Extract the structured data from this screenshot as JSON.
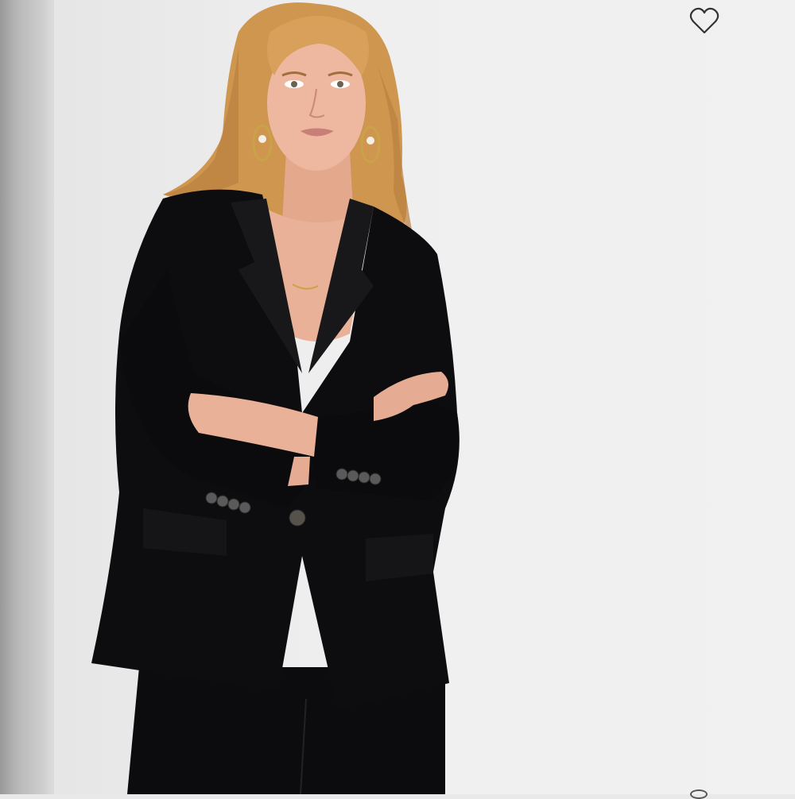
{
  "product_image": {
    "alt": "",
    "subject": "model-in-black-blazer"
  },
  "favorite_button": {
    "icon": "heart-outline-icon",
    "state": "not-favorited",
    "color": "#333333"
  },
  "image_pager": {
    "icon": "carousel-dot-icon"
  },
  "colors": {
    "background": "#efefef",
    "blazer": "#0d0d0f",
    "hair": "#d29a52",
    "skin": "#eab39a"
  }
}
